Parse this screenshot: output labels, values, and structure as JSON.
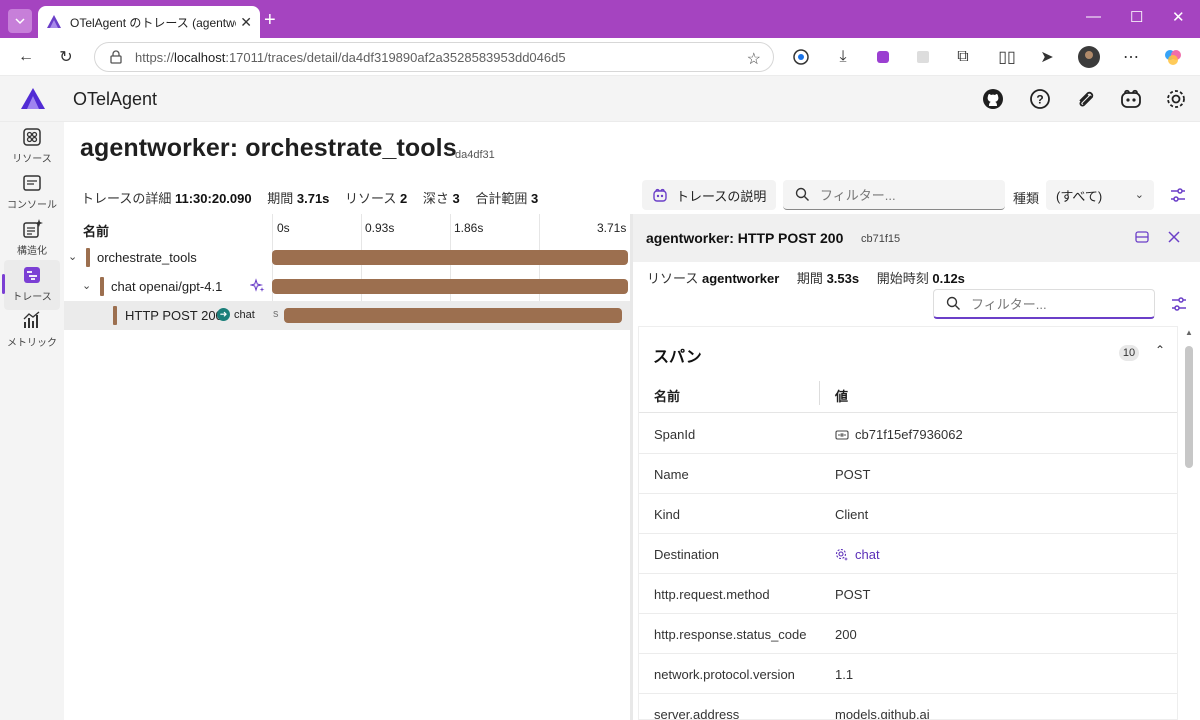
{
  "browser": {
    "tab_title": "OTelAgent のトレース (agentworker: or...",
    "url_prefix": "https://",
    "url_host": "localhost",
    "url_rest": ":17011/traces/detail/da4df319890af2a3528583953dd046d5"
  },
  "app": {
    "title": "OTelAgent"
  },
  "nav": {
    "items": [
      {
        "label": "リソース",
        "icon": "resources-icon"
      },
      {
        "label": "コンソール",
        "icon": "console-icon"
      },
      {
        "label": "構造化",
        "icon": "structured-icon"
      },
      {
        "label": "トレース",
        "icon": "traces-icon",
        "active": true
      },
      {
        "label": "メトリック",
        "icon": "metrics-icon"
      }
    ]
  },
  "page": {
    "title": "agentworker: orchestrate_tools",
    "trace_id": "da4df31",
    "summary": {
      "detail_label": "トレースの詳細",
      "detail_value": "11:30:20.090",
      "duration_label": "期間",
      "duration_value": "3.71s",
      "resources_label": "リソース",
      "resources_value": "2",
      "depth_label": "深さ",
      "depth_value": "3",
      "total_label": "合計範囲",
      "total_value": "3"
    },
    "explain_button": "トレースの説明",
    "filter_placeholder": "フィルター...",
    "kind_label": "種類",
    "kind_value": "(すべて)"
  },
  "waterfall": {
    "name_header": "名前",
    "ticks": [
      "0s",
      "0.93s",
      "1.86s",
      "3.71s"
    ],
    "rows": [
      {
        "name": "orchestrate_tools",
        "start_s": 0,
        "duration_s": 3.71,
        "color": "#9c6f4f"
      },
      {
        "name": "chat openai/gpt-4.1",
        "start_s": 0,
        "duration_s": 3.71,
        "color": "#9c6f4f"
      },
      {
        "name": "HTTP POST 200",
        "destination": "chat",
        "start_s": 0.12,
        "duration_s": 3.53,
        "bar_label": "s",
        "color": "#9c6f4f",
        "selected": true
      }
    ]
  },
  "detail": {
    "title": "agentworker: HTTP POST 200",
    "span_id_short": "cb71f15",
    "resource_label": "リソース",
    "resource_value": "agentworker",
    "duration_label": "期間",
    "duration_value": "3.53s",
    "start_label": "開始時刻",
    "start_value": "0.12s",
    "filter_placeholder": "フィルター...",
    "section_title": "スパン",
    "section_count": "10",
    "col_name": "名前",
    "col_value": "値",
    "rows": [
      {
        "name": "SpanId",
        "value": "cb71f15ef7936062",
        "icon": "id-icon"
      },
      {
        "name": "Name",
        "value": "POST"
      },
      {
        "name": "Kind",
        "value": "Client"
      },
      {
        "name": "Destination",
        "value": "chat",
        "icon": "gear-icon",
        "link": true
      },
      {
        "name": "http.request.method",
        "value": "POST"
      },
      {
        "name": "http.response.status_code",
        "value": "200"
      },
      {
        "name": "network.protocol.version",
        "value": "1.1"
      },
      {
        "name": "server.address",
        "value": "models.github.ai"
      }
    ]
  },
  "colors": {
    "titlebar": "#a544c0",
    "accent": "#6b3fc8",
    "span_bar": "#9c6f4f"
  }
}
